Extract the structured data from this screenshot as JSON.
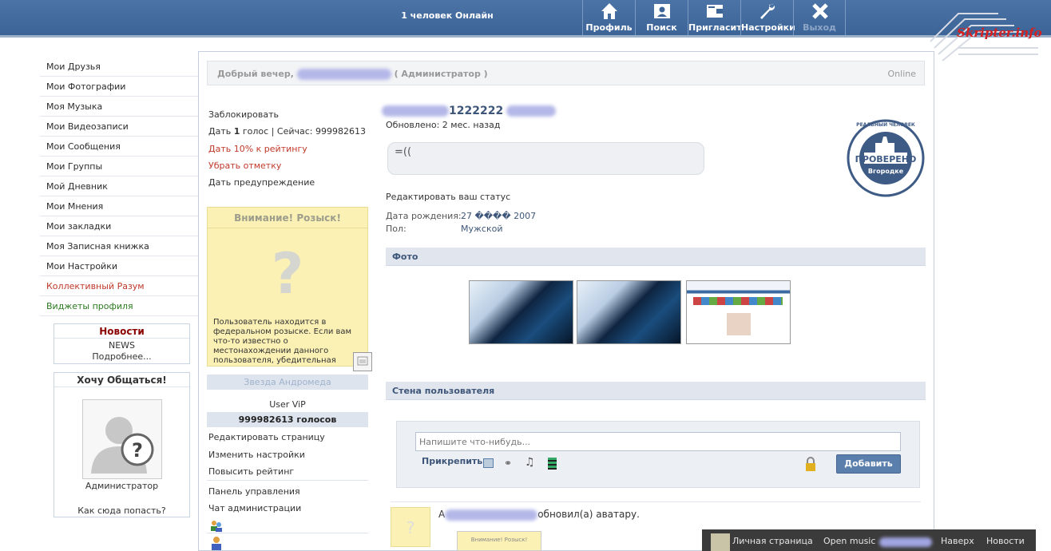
{
  "topbar": {
    "online_text": "1 человек Онлайн",
    "nav": [
      {
        "label": "Профиль",
        "icon": "home-icon"
      },
      {
        "label": "Поиск",
        "icon": "search-user-icon"
      },
      {
        "label": "Пригласит",
        "icon": "wallet-icon"
      },
      {
        "label": "Настройки",
        "icon": "wrench-icon"
      },
      {
        "label": "Выход",
        "icon": "close-icon"
      }
    ],
    "logo_text": "Skripter.info"
  },
  "left_menu": {
    "items": [
      {
        "label": "Мои Друзья"
      },
      {
        "label": "Мои Фотографии"
      },
      {
        "label": "Моя Музыка"
      },
      {
        "label": "Мои Видеозаписи"
      },
      {
        "label": "Мои Сообщения"
      },
      {
        "label": "Мои Группы"
      },
      {
        "label": "Мой Дневник"
      },
      {
        "label": "Мои Мнения"
      },
      {
        "label": "Мои закладки"
      },
      {
        "label": "Моя Записная книжка"
      },
      {
        "label": "Мои Настройки"
      },
      {
        "label": "Коллективный Разум"
      },
      {
        "label": "Виджеты профиля"
      }
    ]
  },
  "news_box": {
    "title": "Новости",
    "line1": "NEWS",
    "more": "Подробнее..."
  },
  "chat_box": {
    "title": "Хочу Общаться!",
    "user": "Администратор",
    "how": "Как сюда попасть?"
  },
  "greeting": {
    "prefix": "Добрый вечер,",
    "suffix": "( Администратор )",
    "status": "Online"
  },
  "actions": {
    "block": "Заблокировать",
    "vote_prefix": "Дать",
    "vote_count": "1",
    "vote_suffix": "голос | Сейчас: 999982613",
    "give_rating": "Дать 10% к рейтингу",
    "remove_mark": "Убрать отметку",
    "warning": "Дать предупреждение"
  },
  "wanted": {
    "title": "Внимание! Розыск!",
    "text": "Пользователь находится в федеральном розыске. Если вам что-то известно о местонахождении данного пользователя, убедительная"
  },
  "profile_side": {
    "star": "Звезда Андромеда",
    "vip": "User ViP",
    "votes": "999982613 голосов",
    "links": [
      "Редактировать страницу",
      "Изменить настройки",
      "Повысить рейтинг"
    ],
    "admin_links": [
      "Панель управления",
      "Чат администрации"
    ]
  },
  "profile": {
    "name_visible": "1222222",
    "updated": "Обновлено: 2 мес. назад",
    "status": "=((",
    "edit_status": "Редактировать ваш статус",
    "birth_label": "Дата рождения:",
    "birth_value": "27 ���� 2007",
    "sex_label": "Пол:",
    "sex_value": "Мужской",
    "stamp_top": "РЕАЛЬНЫЙ ЧЕЛОВЕК",
    "stamp_mid": "ПРОВЕРЕНО",
    "stamp_bottom": "Вгородке"
  },
  "photos": {
    "title": "Фото",
    "count": 3
  },
  "wall": {
    "title": "Стена пользователя",
    "placeholder": "Напишите что-нибудь...",
    "attach": "Прикрепить",
    "add_button": "Добавить",
    "post_prefix": "А",
    "post_text": "обновил(а) аватару.",
    "post_image_title": "Внимание! Розыск!"
  },
  "bottom_bar": {
    "items": [
      "Личная страница",
      "Open music",
      "Наверх",
      "Новости"
    ]
  },
  "colors": {
    "topbar": "#3c6497",
    "link_red": "#c0392b",
    "link_green": "#2a7a1e",
    "accent_button": "#5b7fad"
  }
}
